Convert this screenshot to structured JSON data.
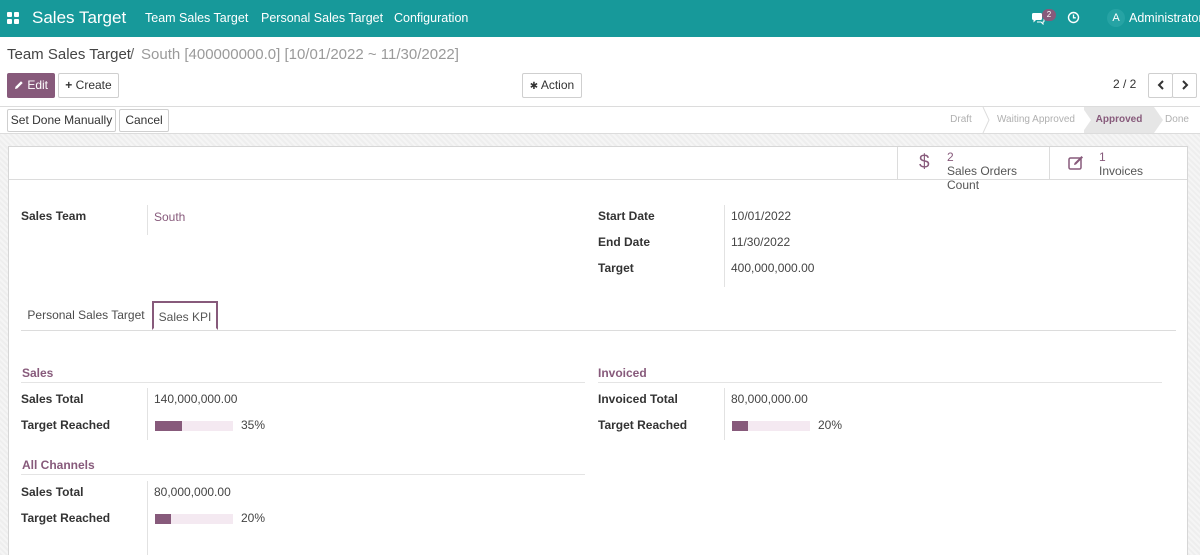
{
  "topbar": {
    "brand": "Sales Target",
    "menu": [
      "Team Sales Target",
      "Personal Sales Target",
      "Configuration"
    ],
    "messages_badge": "2",
    "user_initial": "A",
    "user_name": "Administrator"
  },
  "breadcrumb": {
    "root": "Team Sales Target",
    "separator": "/",
    "current": "South [400000000.0] [10/01/2022 ~ 11/30/2022]"
  },
  "toolbar": {
    "edit_label": "Edit",
    "create_label": "Create",
    "action_label": "Action",
    "pager": "2 / 2"
  },
  "statusbar": {
    "set_done_label": "Set Done Manually",
    "cancel_label": "Cancel",
    "stages": [
      "Draft",
      "Waiting Approved",
      "Approved",
      "Done"
    ],
    "active_stage": "Approved"
  },
  "smart_buttons": {
    "sales_orders": {
      "count": "2",
      "label": "Sales Orders Count"
    },
    "invoices": {
      "count": "1",
      "label": "Invoices"
    }
  },
  "fields": {
    "sales_team_label": "Sales Team",
    "sales_team_value": "South",
    "start_date_label": "Start Date",
    "start_date_value": "10/01/2022",
    "end_date_label": "End Date",
    "end_date_value": "11/30/2022",
    "target_label": "Target",
    "target_value": "400,000,000.00"
  },
  "tabs": [
    "Personal Sales Target",
    "Sales KPI"
  ],
  "active_tab": "Sales KPI",
  "kpi": {
    "sales": {
      "title": "Sales",
      "total_label": "Sales Total",
      "total_value": "140,000,000.00",
      "reached_label": "Target Reached",
      "reached_percent": 35,
      "reached_text": "35%"
    },
    "invoiced": {
      "title": "Invoiced",
      "total_label": "Invoiced Total",
      "total_value": "80,000,000.00",
      "reached_label": "Target Reached",
      "reached_percent": 20,
      "reached_text": "20%"
    },
    "all_channels": {
      "title": "All Channels",
      "total_label": "Sales Total",
      "total_value": "80,000,000.00",
      "reached_label": "Target Reached",
      "reached_percent": 20,
      "reached_text": "20%"
    }
  },
  "colors": {
    "navbar": "#17999a",
    "primary": "#875a7b",
    "progress_track": "#f4e9f1"
  }
}
